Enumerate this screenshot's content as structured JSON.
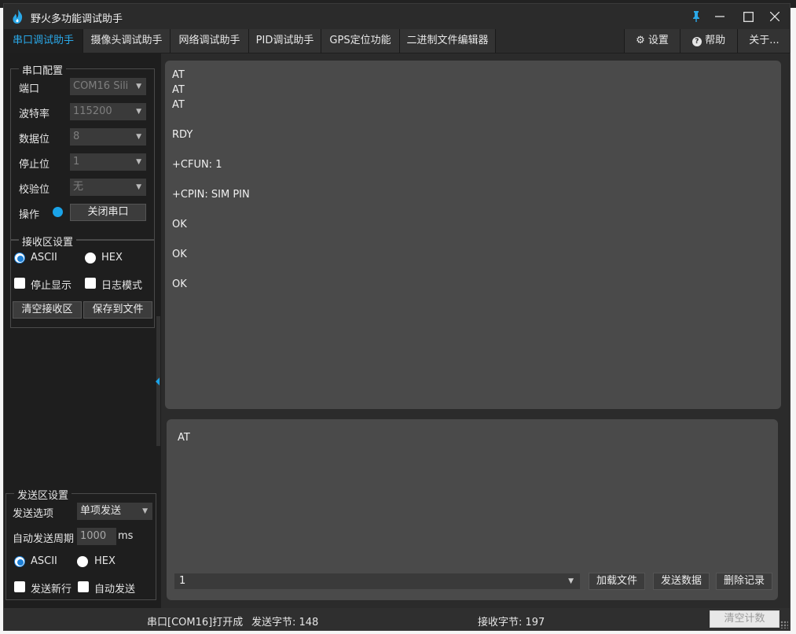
{
  "window": {
    "title": "野火多功能调试助手"
  },
  "tabs": [
    {
      "label": "串口调试助手",
      "active": true
    },
    {
      "label": "摄像头调试助手"
    },
    {
      "label": "网络调试助手"
    },
    {
      "label": "PID调试助手"
    },
    {
      "label": "GPS定位功能"
    },
    {
      "label": "二进制文件编辑器"
    }
  ],
  "right_tabs": {
    "settings": "设置",
    "help": "帮助",
    "about": "关于..."
  },
  "serial_config": {
    "title": "串口配置",
    "port_label": "端口",
    "port_value": "COM16 Sili",
    "baud_label": "波特率",
    "baud_value": "115200",
    "databits_label": "数据位",
    "databits_value": "8",
    "stopbits_label": "停止位",
    "stopbits_value": "1",
    "parity_label": "校验位",
    "parity_value": "无",
    "op_label": "操作",
    "close_button": "关闭串口"
  },
  "recv_settings": {
    "title": "接收区设置",
    "ascii": "ASCII",
    "hex": "HEX",
    "stop_display": "停止显示",
    "log_mode": "日志模式",
    "clear_recv": "清空接收区",
    "save_file": "保存到文件"
  },
  "send_settings": {
    "title": "发送区设置",
    "send_option_label": "发送选项",
    "send_option_value": "单项发送",
    "auto_period_label": "自动发送周期",
    "auto_period_value": "1000",
    "auto_period_unit": "ms",
    "ascii": "ASCII",
    "hex": "HEX",
    "send_newline": "发送新行",
    "auto_send": "自动发送"
  },
  "receive_lines": [
    "AT",
    "AT",
    "AT",
    "",
    "RDY",
    "",
    "+CFUN: 1",
    "",
    "+CPIN: SIM PIN",
    "",
    "OK",
    "",
    "OK",
    "",
    "OK"
  ],
  "send_text": "AT",
  "send_bar": {
    "selected": "1",
    "load_file": "加载文件",
    "send_data": "发送数据",
    "delete_record": "删除记录"
  },
  "status": {
    "port_status": "串口[COM16]打开成",
    "sent_bytes": "发送字节: 148",
    "recv_bytes": "接收字节: 197",
    "clear_count": "清空计数"
  },
  "colors": {
    "accent": "#2aa8e8",
    "panel": "#1e1e1e",
    "text_area": "#4a4a4a"
  }
}
